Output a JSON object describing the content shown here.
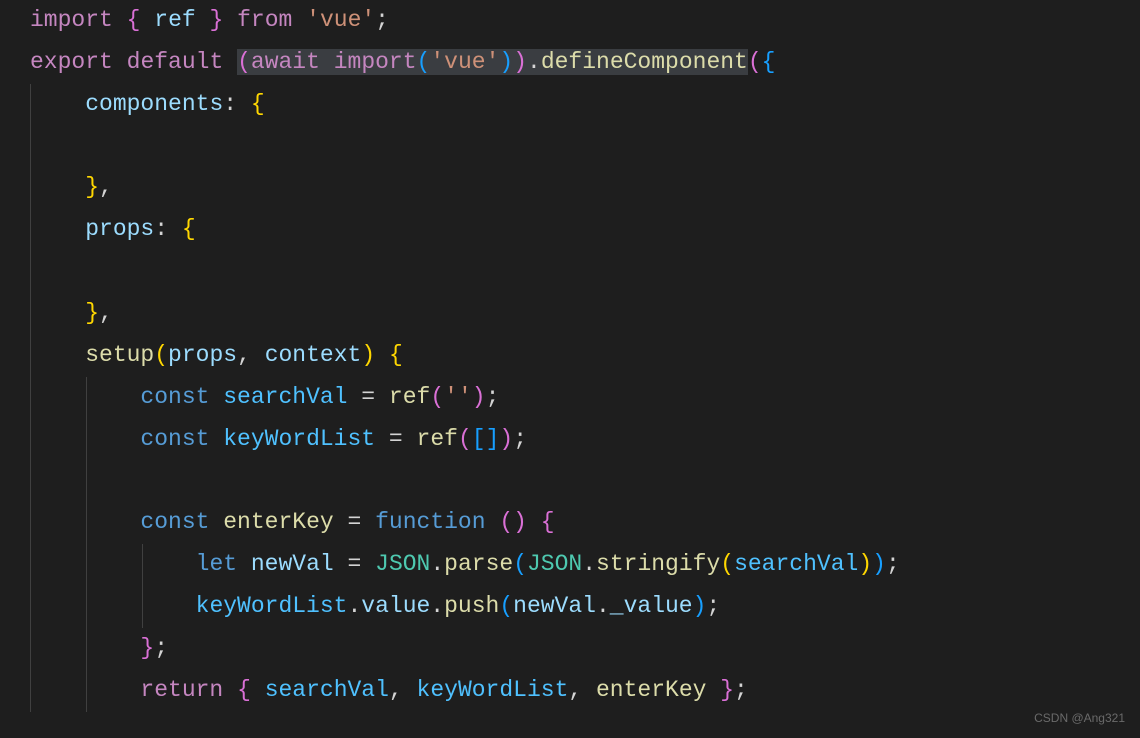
{
  "watermark": "CSDN @Ang321",
  "code": {
    "line1": {
      "import": "import",
      "brace_open": "{",
      "ref": "ref",
      "brace_close": "}",
      "from": "from",
      "vue_string": "'vue'",
      "semi": ";"
    },
    "line2": {
      "export": "export",
      "default": "default",
      "paren_open": "(",
      "await": "await",
      "import_fn": "import",
      "paren_open2": "(",
      "vue_string": "'vue'",
      "paren_close2": ")",
      "paren_close": ")",
      "dot": ".",
      "defineComponent": "defineComponent",
      "paren_open3": "(",
      "brace_open": "{"
    },
    "line3": {
      "components": "components",
      "colon": ":",
      "brace_open": "{"
    },
    "line5": {
      "brace_close": "}",
      "comma": ","
    },
    "line6": {
      "props": "props",
      "colon": ":",
      "brace_open": "{"
    },
    "line8": {
      "brace_close": "}",
      "comma": ","
    },
    "line9": {
      "setup": "setup",
      "paren_open": "(",
      "props": "props",
      "comma1": ",",
      "context": "context",
      "paren_close": ")",
      "brace_open": "{"
    },
    "line10": {
      "const": "const",
      "searchVal": "searchVal",
      "equals": "=",
      "ref": "ref",
      "paren_open": "(",
      "empty_string": "''",
      "paren_close": ")",
      "semi": ";"
    },
    "line11": {
      "const": "const",
      "keyWordList": "keyWordList",
      "equals": "=",
      "ref": "ref",
      "paren_open": "(",
      "bracket_open": "[",
      "bracket_close": "]",
      "paren_close": ")",
      "semi": ";"
    },
    "line13": {
      "const": "const",
      "enterKey": "enterKey",
      "equals": "=",
      "function": "function",
      "paren_open": "(",
      "paren_close": ")",
      "brace_open": "{"
    },
    "line14": {
      "let": "let",
      "newVal": "newVal",
      "equals": "=",
      "JSON1": "JSON",
      "dot1": ".",
      "parse": "parse",
      "paren_open1": "(",
      "JSON2": "JSON",
      "dot2": ".",
      "stringify": "stringify",
      "paren_open2": "(",
      "searchVal": "searchVal",
      "paren_close2": ")",
      "paren_close1": ")",
      "semi": ";"
    },
    "line15": {
      "keyWordList": "keyWordList",
      "dot1": ".",
      "value": "value",
      "dot2": ".",
      "push": "push",
      "paren_open": "(",
      "newVal": "newVal",
      "dot3": ".",
      "_value": "_value",
      "paren_close": ")",
      "semi": ";"
    },
    "line16": {
      "brace_close": "}",
      "semi": ";"
    },
    "line17": {
      "return": "return",
      "brace_open": "{",
      "searchVal": "searchVal",
      "comma1": ",",
      "keyWordList": "keyWordList",
      "comma2": ",",
      "enterKey": "enterKey",
      "brace_close": "}",
      "semi": ";"
    }
  }
}
